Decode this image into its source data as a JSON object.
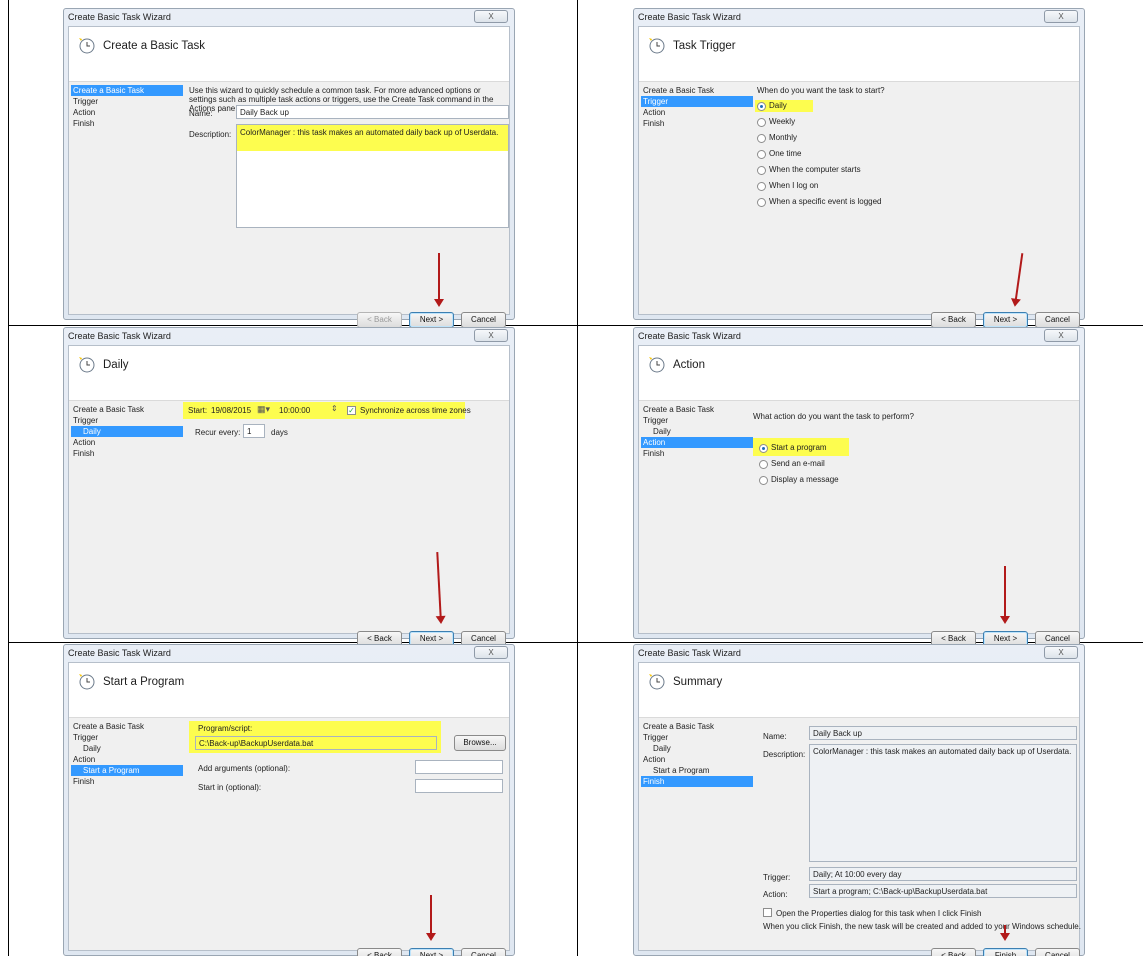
{
  "window_title": "Create Basic Task Wizard",
  "close_glyph": "X",
  "buttons": {
    "back": "< Back",
    "next": "Next >",
    "cancel": "Cancel",
    "finish": "Finish",
    "browse": "Browse..."
  },
  "panel1": {
    "title": "Create a Basic Task",
    "nav": [
      "Create a Basic Task",
      "Trigger",
      "Action",
      "Finish"
    ],
    "intro": "Use this wizard to quickly schedule a common task.  For more advanced options or settings such as multiple task actions or triggers, use the Create Task command in the Actions pane.",
    "name_label": "Name:",
    "name_value": "Daily Back up",
    "desc_label": "Description:",
    "desc_value": "ColorManager : this task makes an automated daily back up of Userdata."
  },
  "panel2": {
    "title": "Task Trigger",
    "nav": [
      "Create a Basic Task",
      "Trigger",
      "Action",
      "Finish"
    ],
    "question": "When do you want the task to start?",
    "options": [
      "Daily",
      "Weekly",
      "Monthly",
      "One time",
      "When the computer starts",
      "When I log on",
      "When a specific event is logged"
    ]
  },
  "panel3": {
    "title": "Daily",
    "nav": [
      "Create a Basic Task",
      "Trigger",
      "Daily",
      "Action",
      "Finish"
    ],
    "start_label": "Start:",
    "start_date": "19/08/2015",
    "start_time": "10:00:00",
    "sync_label": "Synchronize across time zones",
    "recur_label": "Recur every:",
    "recur_value": "1",
    "recur_unit": "days"
  },
  "panel4": {
    "title": "Action",
    "nav": [
      "Create a Basic Task",
      "Trigger",
      "Daily",
      "Action",
      "Finish"
    ],
    "question": "What action do you want the task to perform?",
    "options": [
      "Start a program",
      "Send an e-mail",
      "Display a message"
    ]
  },
  "panel5": {
    "title": "Start a Program",
    "nav": [
      "Create a Basic Task",
      "Trigger",
      "Daily",
      "Action",
      "Start a Program",
      "Finish"
    ],
    "program_label": "Program/script:",
    "program_value": "C:\\Back-up\\BackupUserdata.bat",
    "args_label": "Add arguments (optional):",
    "startin_label": "Start in (optional):"
  },
  "panel6": {
    "title": "Summary",
    "nav": [
      "Create a Basic Task",
      "Trigger",
      "Daily",
      "Action",
      "Start a Program",
      "Finish"
    ],
    "name_label": "Name:",
    "name_value": "Daily Back up",
    "desc_label": "Description:",
    "desc_value": "ColorManager : this task makes an automated daily back up of Userdata.",
    "trigger_label": "Trigger:",
    "trigger_value": "Daily; At 10:00 every day",
    "action_label": "Action:",
    "action_value": "Start a program; C:\\Back-up\\BackupUserdata.bat",
    "open_props": "Open the Properties dialog for this task when I click Finish",
    "finish_note": "When you click Finish, the new task will be created and added to your Windows schedule."
  },
  "colors": {
    "highlight": "#fdfd4f",
    "nav_active": "#3399ff",
    "arrow": "#b21a1a"
  }
}
